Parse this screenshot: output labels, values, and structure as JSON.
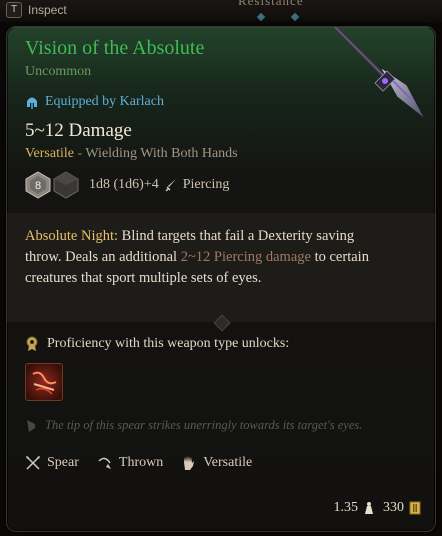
{
  "topbar": {
    "key": "T",
    "inspect_label": "Inspect",
    "behind_text": "Resistance"
  },
  "item": {
    "name": "Vision of the Absolute",
    "rarity": "Uncommon",
    "equipped": "Equipped by Karlach",
    "damage": "5~12 Damage",
    "versatile_keyword": "Versatile",
    "versatile_separator": " - ",
    "versatile_rest": "Wielding With Both Hands",
    "die_value": "8",
    "dice_formula": "1d8 (1d6)+4",
    "damage_type": "Piercing"
  },
  "ability": {
    "name": "Absolute Night:",
    "text1": " Blind targets that fail a Dexterity saving throw. Deals an additional ",
    "dmg": "2~12 Piercing damage",
    "text2": " to certain creatures that sport multiple sets of eyes."
  },
  "proficiency": {
    "label": "Proficiency with this weapon type unlocks:"
  },
  "flavor": "The tip of this spear strikes unerringly towards its target's eyes.",
  "properties": [
    "Spear",
    "Thrown",
    "Versatile"
  ],
  "footer": {
    "weight": "1.35",
    "value": "330"
  },
  "colors": {
    "title": "#3fbb55",
    "rarity": "#6c9a5e",
    "equipped": "#5fb0d8",
    "keyword": "#d8b25a",
    "ability_name": "#e7c06a"
  },
  "icons": {
    "equipped": "helmet-icon",
    "damage_type": "dagger-icon",
    "proficiency": "medal-icon",
    "action": "spear-strike-action-icon",
    "flavor": "feather-icon",
    "spear": "crossed-spears-icon",
    "thrown": "thrown-arc-icon",
    "versatile": "hand-icon",
    "weight": "weight-icon",
    "value": "gold-coin-icon"
  }
}
